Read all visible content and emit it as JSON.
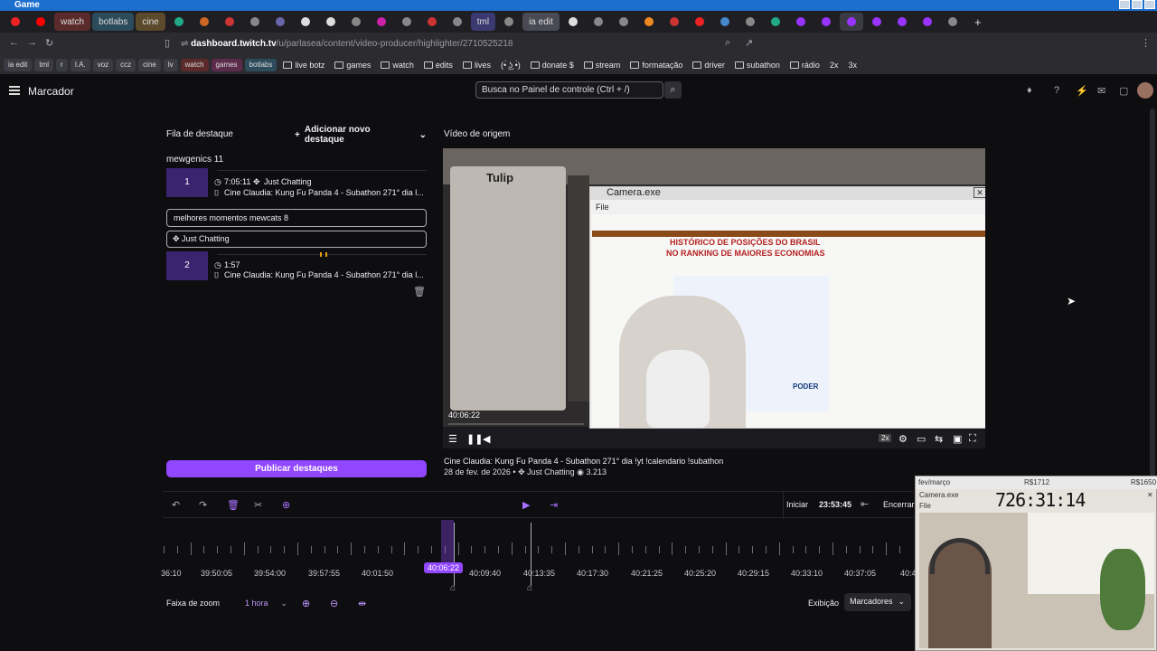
{
  "os": {
    "title": "Game"
  },
  "browser": {
    "tabs": [
      "watch",
      "botlabs",
      "cine",
      "tml",
      "ia edit"
    ],
    "url_host": "dashboard.twitch.tv",
    "url_path": "/u/parlasea/content/video-producer/highlighter/2710525218",
    "bookmark_chips": [
      "ia edit",
      "tml",
      "r",
      "I.A.",
      "voz",
      "ccz",
      "cine",
      "lv",
      "watch",
      "games",
      "botlabs"
    ],
    "bookmarks": [
      "live botz",
      "games",
      "watch",
      "edits",
      "lives",
      "(•́ ͜ʖ •̀)",
      "donate $",
      "stream",
      "formatação",
      "driver",
      "subathon",
      "rádio",
      "2x",
      "3x"
    ]
  },
  "header": {
    "menu_title": "Marcador",
    "search_placeholder": "Busca no Painel de controle (Ctrl + /)"
  },
  "queue": {
    "title": "Fila de destaque",
    "add_label": "Adicionar novo destaque",
    "group1": "mewgenics 11",
    "item1": {
      "num": "1",
      "time": "7:05:11",
      "category": "Just Chatting",
      "title": "Cine Claudia: Kung Fu Panda 4 - Subathon 271° dia l..."
    },
    "name_field": "melhores momentos mewcats 8",
    "category_field": "Just Chatting",
    "item2": {
      "num": "2",
      "time": "1:57",
      "title": "Cine Claudia: Kung Fu Panda 4 - Subathon 271° dia l..."
    },
    "publish_label": "Publicar destaques"
  },
  "source": {
    "title": "Vídeo de origem",
    "player_time": "40:06:22",
    "video_title": "Cine Claudia: Kung Fu Panda 4 - Subathon 271° dia !yt !calendario !subathon",
    "date": "28 de fev. de 2026",
    "category": "Just Chatting",
    "views": "3.213",
    "speed": "2x",
    "camera_title": "Camera.exe",
    "camera_menu": "File",
    "slide_title1": "HISTÓRICO DE POSIÇÕES DO BRASIL",
    "slide_title2": "NO RANKING DE MAIORES ECONOMIAS",
    "slide_logo": "PODER",
    "game_name": "Tulip"
  },
  "timeline": {
    "start_label": "Iniciar",
    "start_time": "23:53:45",
    "end_label": "Encerrar",
    "ticks": [
      "36:10",
      "39:50:05",
      "39:54:00",
      "39:57:55",
      "40:01:50",
      "40:09:40",
      "40:13:35",
      "40:17:30",
      "40:21:25",
      "40:25:20",
      "40:29:15",
      "40:33:10",
      "40:37:05",
      "40:4"
    ],
    "playhead": "40:06:22",
    "zoom_label": "Faixa de zoom",
    "zoom_value": "1 hora",
    "view_label": "Exibição",
    "view_value": "Marcadores"
  },
  "overlay": {
    "top_text": "fev/março",
    "money1": "R$1712",
    "money2": "R$1650",
    "timer": "726:31:14",
    "cam_title": "Camera.exe",
    "cam_menu": "File"
  }
}
